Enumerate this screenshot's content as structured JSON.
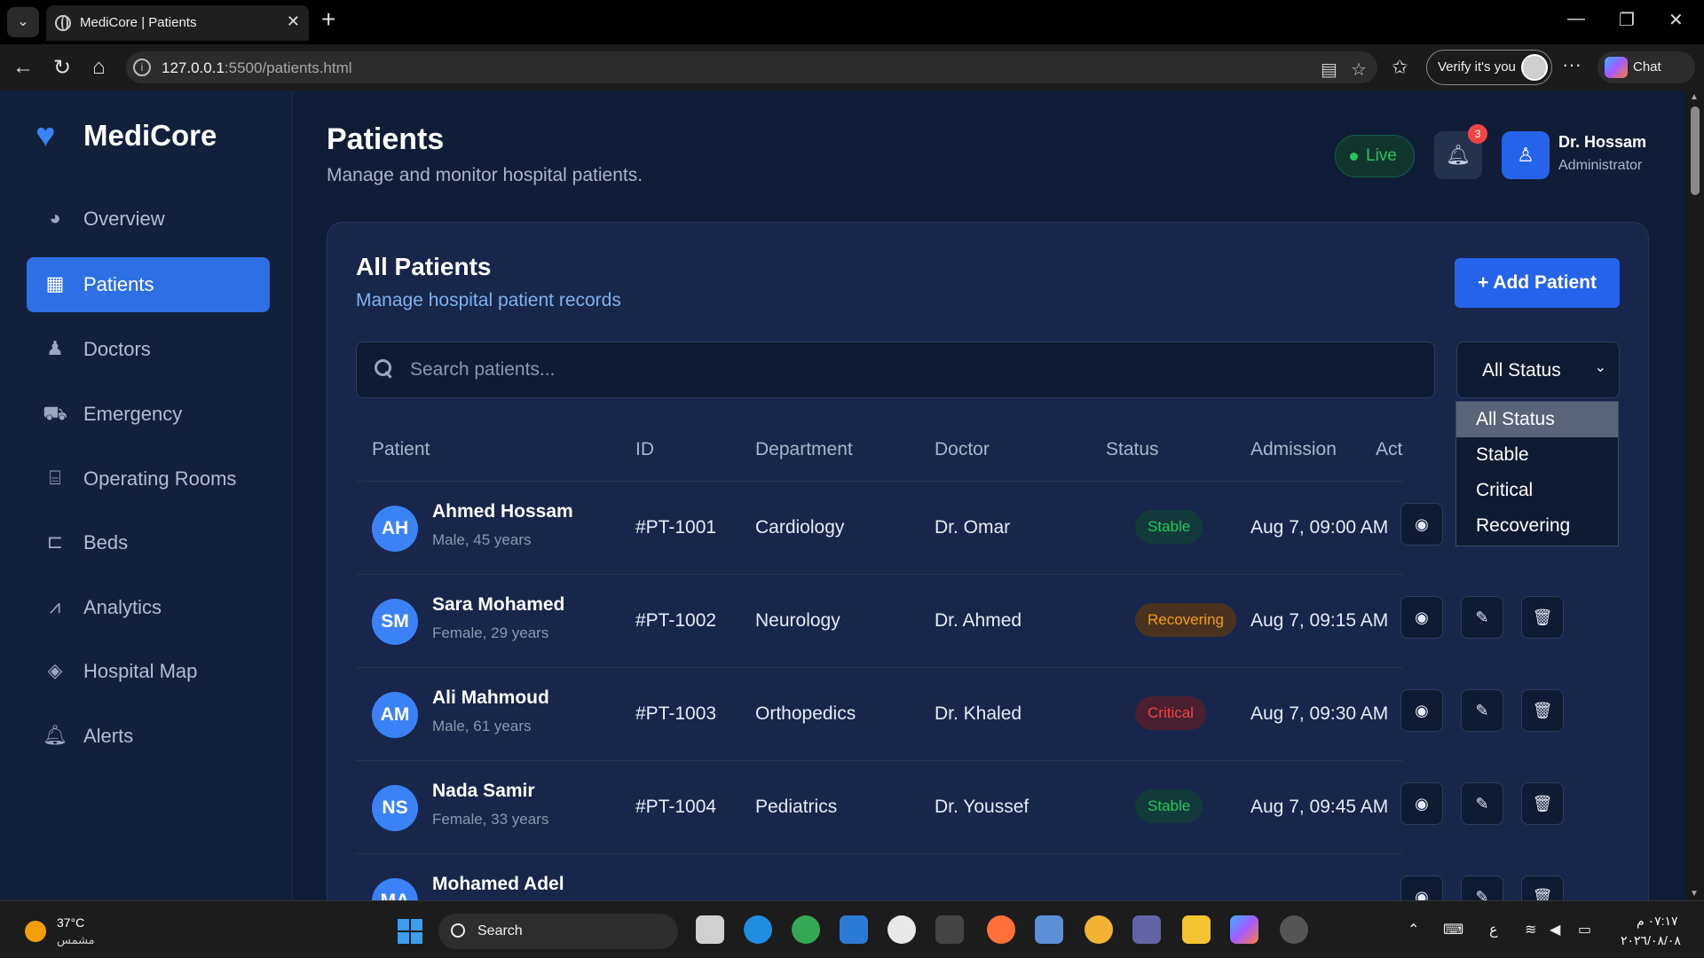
{
  "browser": {
    "tab_title": "MediCore | Patients",
    "url_host": "127.0.0.1",
    "url_path": ":5500/patients.html",
    "verify_label": "Verify it's you",
    "chat_label": "Chat"
  },
  "sidebar": {
    "brand": "MediCore",
    "items": [
      {
        "label": "Overview",
        "icon": "pie-chart-icon",
        "active": false
      },
      {
        "label": "Patients",
        "icon": "patients-icon",
        "active": true
      },
      {
        "label": "Doctors",
        "icon": "doctor-icon",
        "active": false
      },
      {
        "label": "Emergency",
        "icon": "ambulance-icon",
        "active": false
      },
      {
        "label": "Operating Rooms",
        "icon": "procedures-icon",
        "active": false
      },
      {
        "label": "Beds",
        "icon": "bed-icon",
        "active": false
      },
      {
        "label": "Analytics",
        "icon": "line-chart-icon",
        "active": false
      },
      {
        "label": "Hospital Map",
        "icon": "map-icon",
        "active": false
      },
      {
        "label": "Alerts",
        "icon": "bell-icon",
        "active": false
      }
    ]
  },
  "header": {
    "title": "Patients",
    "subtitle": "Manage and monitor hospital patients.",
    "live_label": "Live",
    "notification_count": "3",
    "user_name": "Dr. Hossam",
    "user_role": "Administrator"
  },
  "card": {
    "title": "All Patients",
    "subtitle": "Manage hospital patient records",
    "add_button": "+ Add Patient",
    "search_placeholder": "Search patients...",
    "status_value": "All Status"
  },
  "table": {
    "columns": [
      "Patient",
      "ID",
      "Department",
      "Doctor",
      "Status",
      "Admission",
      "Act"
    ],
    "rows": [
      {
        "initials": "AH",
        "name": "Ahmed Hossam",
        "info": "Male, 45 years",
        "id": "#PT-1001",
        "department": "Cardiology",
        "doctor": "Dr. Omar",
        "status": "Stable",
        "admission": "Aug 7, 09:00 AM"
      },
      {
        "initials": "SM",
        "name": "Sara Mohamed",
        "info": "Female, 29 years",
        "id": "#PT-1002",
        "department": "Neurology",
        "doctor": "Dr. Ahmed",
        "status": "Recovering",
        "admission": "Aug 7, 09:15 AM"
      },
      {
        "initials": "AM",
        "name": "Ali Mahmoud",
        "info": "Male, 61 years",
        "id": "#PT-1003",
        "department": "Orthopedics",
        "doctor": "Dr. Khaled",
        "status": "Critical",
        "admission": "Aug 7, 09:30 AM"
      },
      {
        "initials": "NS",
        "name": "Nada Samir",
        "info": "Female, 33 years",
        "id": "#PT-1004",
        "department": "Pediatrics",
        "doctor": "Dr. Youssef",
        "status": "Stable",
        "admission": "Aug 7, 09:45 AM"
      },
      {
        "initials": "MA",
        "name": "Mohamed Adel",
        "info": "",
        "id": "",
        "department": "",
        "doctor": "",
        "status": "",
        "admission": ""
      }
    ]
  },
  "status_dropdown": {
    "options": [
      "All Status",
      "Stable",
      "Critical",
      "Recovering"
    ],
    "selected": "All Status"
  },
  "taskbar": {
    "temperature": "37°C",
    "weather": "مشمس",
    "search_label": "Search",
    "time": "٠٧:١٧ م",
    "date": "٢٠٢٦/٠٨/٠٨",
    "language": "ع"
  },
  "colors": {
    "accent": "#2563eb",
    "stable": "#22c55e",
    "recovering": "#f59e0b",
    "critical": "#ef4444"
  }
}
